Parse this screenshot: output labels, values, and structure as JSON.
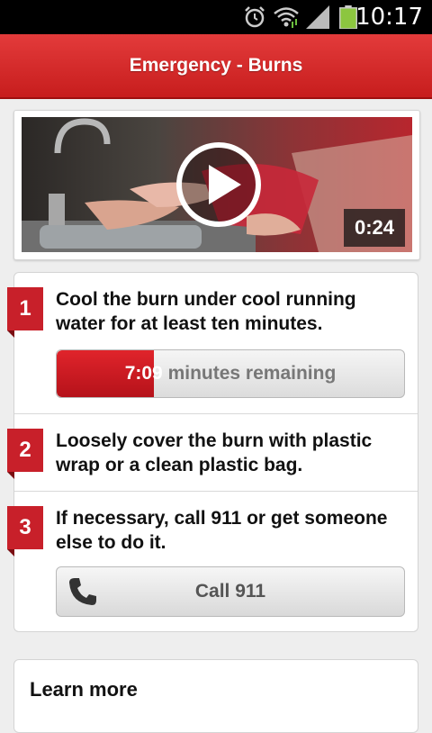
{
  "status_bar": {
    "time": "10:17",
    "icons": [
      "alarm-icon",
      "wifi-icon",
      "signal-icon",
      "battery-icon"
    ]
  },
  "header": {
    "title": "Emergency - Burns"
  },
  "video": {
    "duration": "0:24",
    "icon": "play-icon"
  },
  "steps": [
    {
      "number": "1",
      "text": "Cool the burn under cool running water for at least ten minutes.",
      "timer": {
        "time": "7:09",
        "suffix": " minutes remaining",
        "progress_fraction": 0.28
      }
    },
    {
      "number": "2",
      "text": "Loosely cover the burn with plastic wrap or a clean plastic bag."
    },
    {
      "number": "3",
      "text": "If necessary, call 911 or get someone else to do it.",
      "call_button": {
        "label": "Call 911",
        "icon": "phone-icon"
      }
    }
  ],
  "learn_more": {
    "label": "Learn more"
  },
  "colors": {
    "brand_red": "#c8202a",
    "header_red": "#d42a2a"
  }
}
